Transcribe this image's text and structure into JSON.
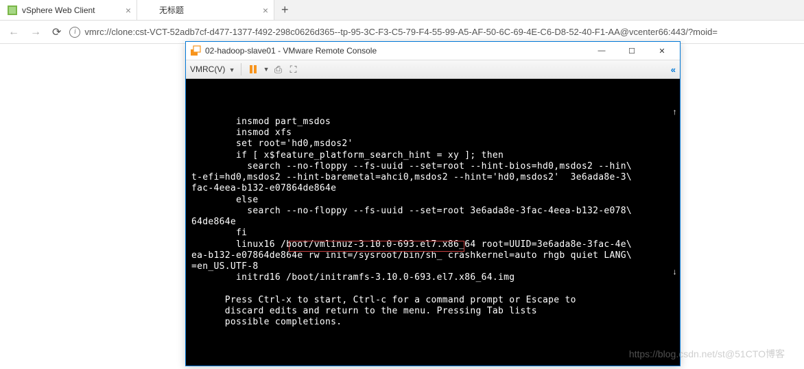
{
  "browser": {
    "tabs": [
      {
        "label": "vSphere Web Client",
        "favicon_color": "#7ab648"
      },
      {
        "label": "无标题",
        "favicon_color": "transparent"
      }
    ],
    "new_tab": "+",
    "nav": {
      "back": "←",
      "forward": "→",
      "reload": "⟳",
      "info": "i",
      "url": "vmrc://clone:cst-VCT-52adb7cf-d477-1377-f492-298c0626d365--tp-95-3C-F3-C5-79-F4-55-99-A5-AF-50-6C-69-4E-C6-D8-52-40-F1-AA@vcenter66:443/?moid="
    }
  },
  "console": {
    "title": "02-hadoop-slave01 - VMware Remote Console",
    "controls": {
      "minimize": "—",
      "maximize": "☐",
      "close": "✕"
    },
    "toolbar": {
      "menu_label": "VMRC(V)",
      "pause_color": "#f7941d",
      "dropdown": "▼",
      "send_keys": "⎙",
      "fullscreen": "⛶",
      "end": "«"
    },
    "terminal_lines": [
      "",
      "",
      "",
      "        insmod part_msdos",
      "        insmod xfs",
      "        set root='hd0,msdos2'",
      "        if [ x$feature_platform_search_hint = xy ]; then",
      "          search --no-floppy --fs-uuid --set=root --hint-bios=hd0,msdos2 --hin\\\nt-efi=hd0,msdos2 --hint-baremetal=ahci0,msdos2 --hint='hd0,msdos2'  3e6ada8e-3\\\nfac-4eea-b132-e07864de864e",
      "        else",
      "          search --no-floppy --fs-uuid --set=root 3e6ada8e-3fac-4eea-b132-e078\\\n64de864e",
      "        fi",
      "        linux16 /boot/vmlinuz-3.10.0-693.el7.x86_64 root=UUID=3e6ada8e-3fac-4e\\\nea-b132-e07864de864e rw init=/sysroot/bin/sh_ crashkernel=auto rhgb quiet LANG\\\n=en_US.UTF-8",
      "        initrd16 /boot/initramfs-3.10.0-693.el7.x86_64.img",
      "",
      "      Press Ctrl-x to start, Ctrl-c for a command prompt or Escape to",
      "      discard edits and return to the menu. Pressing Tab lists",
      "      possible completions."
    ],
    "highlighted": "rw init=/sysroot/bin/sh_"
  },
  "watermark": "https://blog.csdn.net/st@51CTO博客"
}
